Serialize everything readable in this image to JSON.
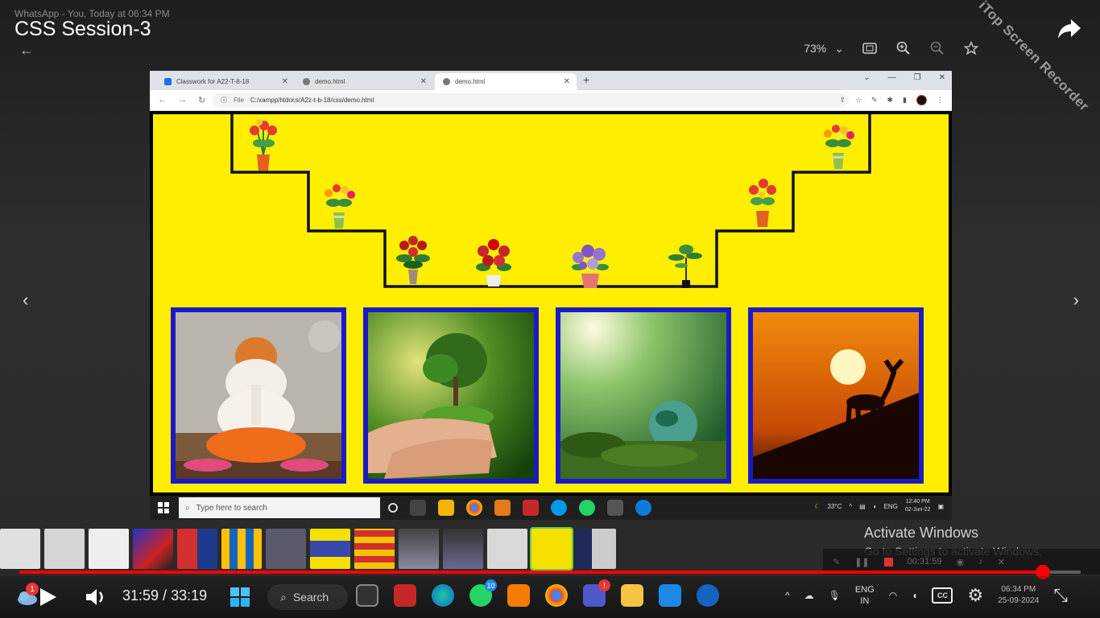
{
  "overlay": {
    "whatsapp_line": "WhatsApp - You, Today at 06:34 PM",
    "video_title": "CSS Session-3",
    "zoom_level": "73%",
    "watermark": "iTop Screen Recorder",
    "prev_arrow": "‹",
    "next_arrow": "›"
  },
  "browser": {
    "tabs": [
      {
        "label": "Classwork for A22-T-8-18",
        "favicon_color": "#1a73e8",
        "close": "✕"
      },
      {
        "label": "demo.html",
        "favicon_color": "#666666",
        "close": "✕"
      },
      {
        "label": "demo.html",
        "favicon_color": "#666666",
        "close": "✕"
      }
    ],
    "new_tab": "+",
    "file_label": "File",
    "url": "C:/xampp/htdocs/A2z-t-b-18/css/demo.html"
  },
  "webpage": {
    "background_color": "#ffee00",
    "border_color": "#1a1ac8",
    "flower_pots": [
      "red-flower-pot",
      "colorful-flower-pot",
      "red-rose-bouquet",
      "red-rose-pot",
      "purple-flower-pot",
      "bonsai-pot",
      "red-flower-pot",
      "colorful-flower-pot"
    ],
    "cards": [
      "ganesha-idol-image",
      "tree-in-hands-image",
      "earth-globe-forest-image",
      "deer-sunset-image"
    ]
  },
  "inner_taskbar": {
    "search_placeholder": "Type here to search",
    "temperature": "33°C",
    "language": "ENG",
    "time": "12:40 PM",
    "date": "02-Jun-22"
  },
  "activation": {
    "title": "Activate Windows",
    "subtitle": "Go to Settings to activate Windows."
  },
  "recorder": {
    "timer": "00:31:59"
  },
  "player": {
    "current_time": "31:59",
    "separator": " / ",
    "duration": "33:19",
    "progress_fraction": 0.964,
    "accent_color": "#ff0000"
  },
  "taskbar": {
    "search_label": "Search",
    "weather_badge": "1",
    "whatsapp_badge": "10",
    "teams_badge": "!",
    "language_top": "ENG",
    "language_bottom": "IN",
    "time": "06:34 PM",
    "date": "25-09-2024",
    "cc_label": "CC"
  }
}
